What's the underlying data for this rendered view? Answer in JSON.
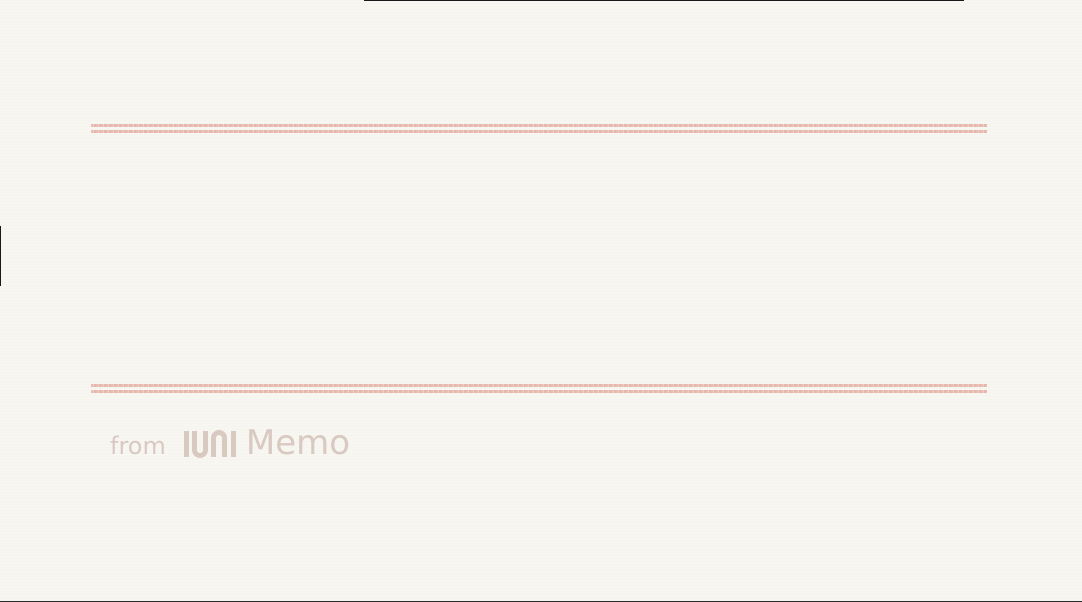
{
  "memo": {
    "body_text": "",
    "footer": {
      "from_label": "from",
      "brand_logo_text": "IUNI",
      "brand_logo_icon": "iuni-logo-icon",
      "brand_name": "Memo"
    }
  },
  "colors": {
    "paper": "#f8f6f1",
    "rule": "#e6b7ad",
    "signature": "#d8c9c1"
  }
}
